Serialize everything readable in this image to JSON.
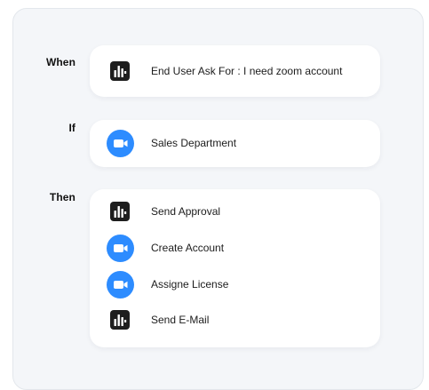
{
  "sections": {
    "when_label": "When",
    "if_label": "If",
    "then_label": "Then"
  },
  "when": {
    "text": "End User Ask For : I need zoom account",
    "icon": "report-app-icon"
  },
  "if": {
    "text": "Sales Department",
    "icon": "zoom-camera-icon"
  },
  "then": {
    "steps": [
      {
        "text": "Send Approval",
        "icon": "report-app-icon"
      },
      {
        "text": "Create Account",
        "icon": "zoom-camera-icon"
      },
      {
        "text": "Assigne License",
        "icon": "zoom-camera-icon"
      },
      {
        "text": "Send E-Mail",
        "icon": "report-app-icon"
      }
    ]
  },
  "colors": {
    "zoom_blue": "#2d8cff",
    "report_dark": "#1e1e1e",
    "panel_bg": "#f4f6f9",
    "card_bg": "#ffffff"
  }
}
